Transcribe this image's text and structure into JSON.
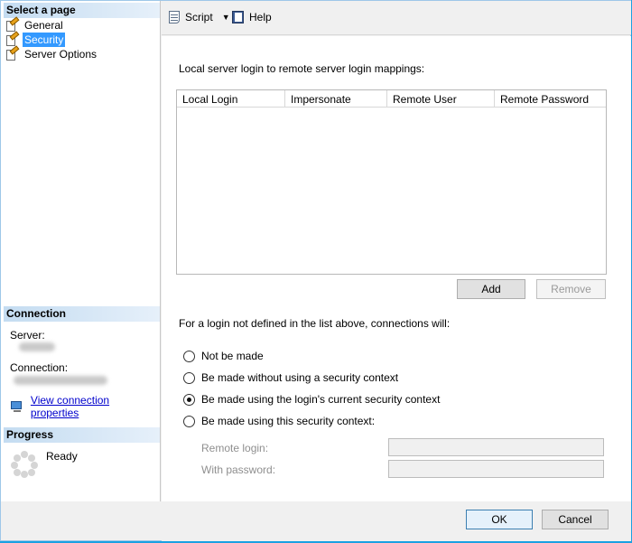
{
  "sidebar": {
    "select_page_title": "Select a page",
    "pages": [
      {
        "label": "General"
      },
      {
        "label": "Security"
      },
      {
        "label": "Server Options"
      }
    ],
    "connection_title": "Connection",
    "server_label": "Server:",
    "connection_label": "Connection:",
    "view_connection_link": "View connection properties",
    "progress_title": "Progress",
    "progress_status": "Ready"
  },
  "toolbar": {
    "script_label": "Script",
    "help_label": "Help"
  },
  "main": {
    "mapping_label": "Local server login to remote server login mappings:",
    "grid_columns": [
      "Local Login",
      "Impersonate",
      "Remote User",
      "Remote Password"
    ],
    "add_button": "Add",
    "remove_button": "Remove",
    "for_login_label": "For a login not defined in the list above, connections will:",
    "options": [
      {
        "label": "Not be made",
        "checked": false
      },
      {
        "label": "Be made without using a security context",
        "checked": false
      },
      {
        "label": "Be made using the login's current security context",
        "checked": true
      },
      {
        "label": "Be made using this security context:",
        "checked": false
      }
    ],
    "remote_login_label": "Remote login:",
    "with_password_label": "With password:",
    "remote_login_value": "",
    "with_password_value": ""
  },
  "footer": {
    "ok_button": "OK",
    "cancel_button": "Cancel"
  }
}
